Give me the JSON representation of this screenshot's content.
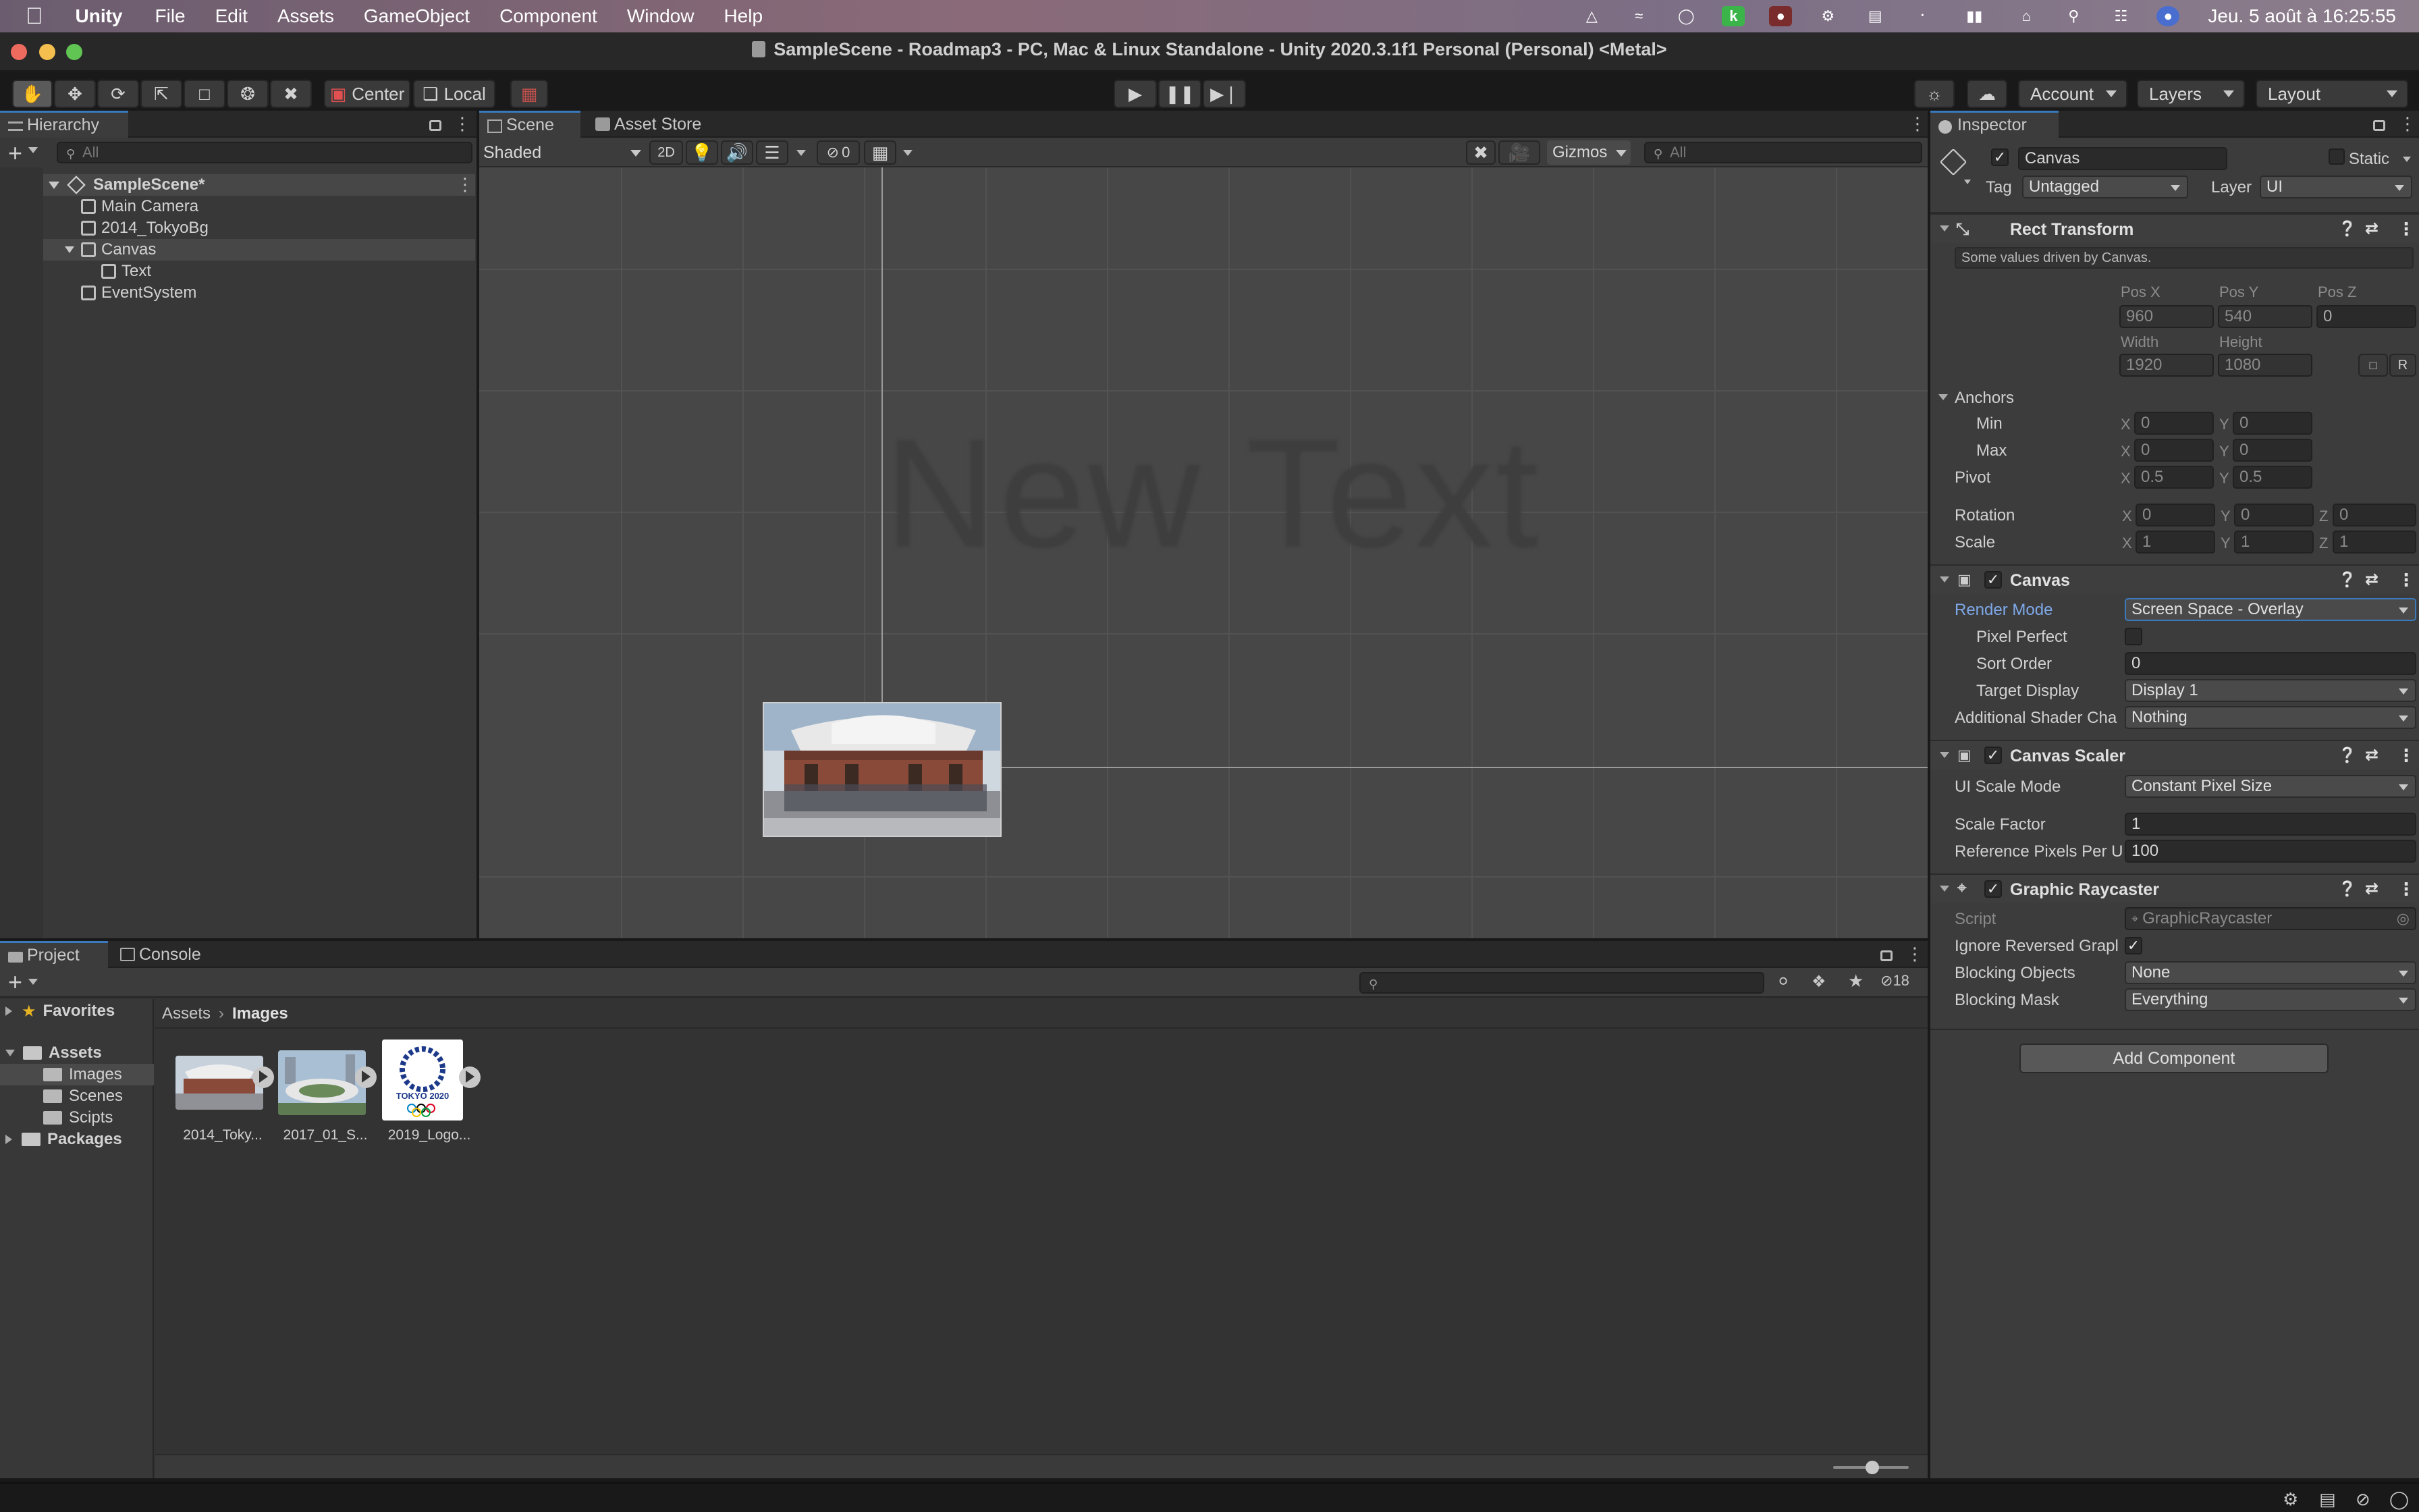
{
  "menubar": {
    "app": "Unity",
    "items": [
      "File",
      "Edit",
      "Assets",
      "GameObject",
      "Component",
      "Window",
      "Help"
    ],
    "clock": "Jeu. 5 août à  16:25:55"
  },
  "window": {
    "title": "SampleScene - Roadmap3 - PC, Mac & Linux Standalone - Unity 2020.3.1f1 Personal (Personal) <Metal>"
  },
  "toolbar": {
    "center_label": "Center",
    "local_label": "Local",
    "account_label": "Account",
    "layers_label": "Layers",
    "layout_label": "Layout"
  },
  "hierarchy": {
    "tab_label": "Hierarchy",
    "search_placeholder": "All",
    "scene": "SampleScene*",
    "items": [
      "Main Camera",
      "2014_TokyoBg",
      "Canvas",
      "Text",
      "EventSystem"
    ]
  },
  "scene": {
    "tabs": [
      "Scene",
      "Asset Store"
    ],
    "shading": "Shaded",
    "mode_2d": "2D",
    "hidden_count": "0",
    "gizmos_label": "Gizmos",
    "search_placeholder": "All",
    "placeholder_text": "New Text"
  },
  "inspector": {
    "tab_label": "Inspector",
    "object_name": "Canvas",
    "static_label": "Static",
    "tag_label": "Tag",
    "tag_value": "Untagged",
    "layer_label": "Layer",
    "layer_value": "UI",
    "rect_transform": {
      "title": "Rect Transform",
      "note": "Some values driven by Canvas.",
      "pos_x_label": "Pos X",
      "pos_y_label": "Pos Y",
      "pos_z_label": "Pos Z",
      "pos_x": "960",
      "pos_y": "540",
      "pos_z": "0",
      "width_label": "Width",
      "height_label": "Height",
      "width": "1920",
      "height": "1080",
      "r_label": "R",
      "anchors_label": "Anchors",
      "min_label": "Min",
      "max_label": "Max",
      "min_x": "0",
      "min_y": "0",
      "max_x": "0",
      "max_y": "0",
      "pivot_label": "Pivot",
      "pivot_x": "0.5",
      "pivot_y": "0.5",
      "rotation_label": "Rotation",
      "rot_x": "0",
      "rot_y": "0",
      "rot_z": "0",
      "scale_label": "Scale",
      "scale_x": "1",
      "scale_y": "1",
      "scale_z": "1",
      "axis_x": "X",
      "axis_y": "Y",
      "axis_z": "Z"
    },
    "canvas": {
      "title": "Canvas",
      "render_mode_label": "Render Mode",
      "render_mode_value": "Screen Space - Overlay",
      "pixel_perfect_label": "Pixel Perfect",
      "sort_order_label": "Sort Order",
      "sort_order_value": "0",
      "target_display_label": "Target Display",
      "target_display_value": "Display 1",
      "shader_channels_label": "Additional Shader Cha",
      "shader_channels_value": "Nothing"
    },
    "canvas_scaler": {
      "title": "Canvas Scaler",
      "scale_mode_label": "UI Scale Mode",
      "scale_mode_value": "Constant Pixel Size",
      "scale_factor_label": "Scale Factor",
      "scale_factor_value": "1",
      "ref_pixels_label": "Reference Pixels Per U",
      "ref_pixels_value": "100"
    },
    "graphic_raycaster": {
      "title": "Graphic Raycaster",
      "script_label": "Script",
      "script_value": "GraphicRaycaster",
      "ignore_reversed_label": "Ignore Reversed Grapl",
      "blocking_objects_label": "Blocking Objects",
      "blocking_objects_value": "None",
      "blocking_mask_label": "Blocking Mask",
      "blocking_mask_value": "Everything"
    },
    "add_component": "Add Component"
  },
  "project": {
    "tabs": [
      "Project",
      "Console"
    ],
    "hidden_count": "18",
    "tree": {
      "favorites": "Favorites",
      "assets": "Assets",
      "images": "Images",
      "scenes": "Scenes",
      "scripts": "Scipts",
      "packages": "Packages"
    },
    "breadcrumb": [
      "Assets",
      "Images"
    ],
    "assets": [
      "2014_Toky...",
      "2017_01_S...",
      "2019_Logo..."
    ],
    "logo_text": "TOKYO 2020"
  },
  "colors": {
    "accent": "#3a79bb",
    "panel": "#383838",
    "scene_bg": "#474747"
  }
}
